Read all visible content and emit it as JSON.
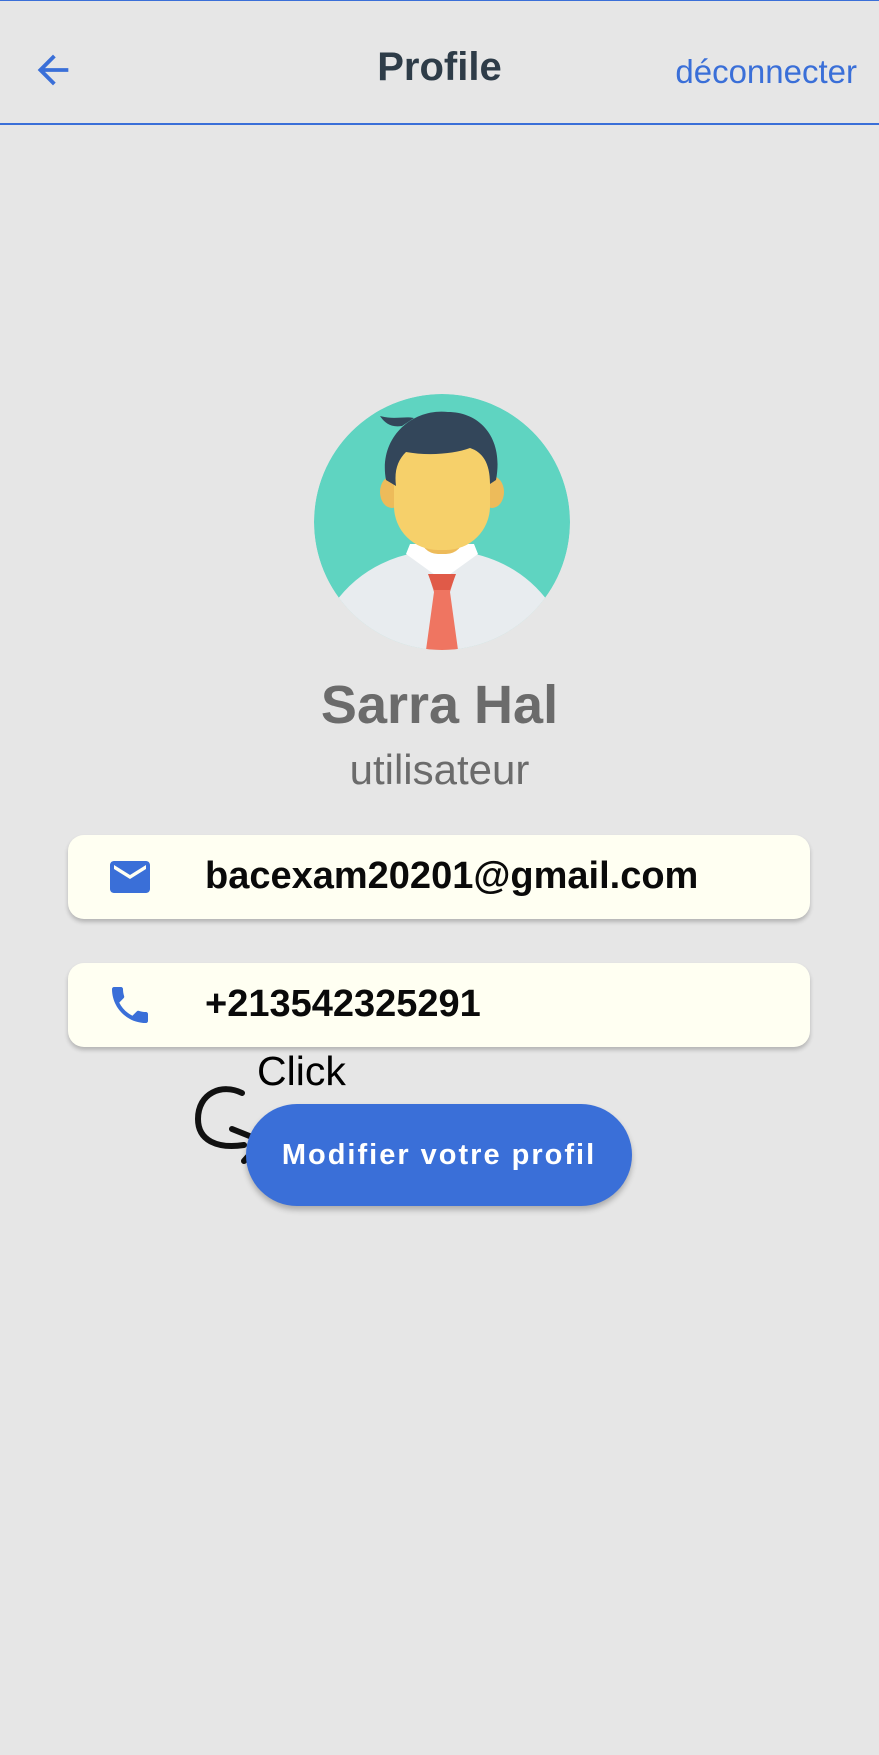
{
  "header": {
    "title": "Profile",
    "logout_label": "déconnecter",
    "back_icon": "arrow-back-icon"
  },
  "profile": {
    "name": "Sarra Hal",
    "role": "utilisateur",
    "avatar_icon": "user-avatar-icon"
  },
  "contact": {
    "email": "bacexam20201@gmail.com",
    "email_icon": "mail-icon",
    "phone": "+213542325291",
    "phone_icon": "phone-icon"
  },
  "annotation": {
    "note": "Click"
  },
  "actions": {
    "edit_profile_label": "Modifier votre profil"
  },
  "colors": {
    "accent": "#3a6fd8",
    "background": "#e6e6e6",
    "card_background": "#fffff2",
    "avatar_background": "#5fd4c1"
  }
}
